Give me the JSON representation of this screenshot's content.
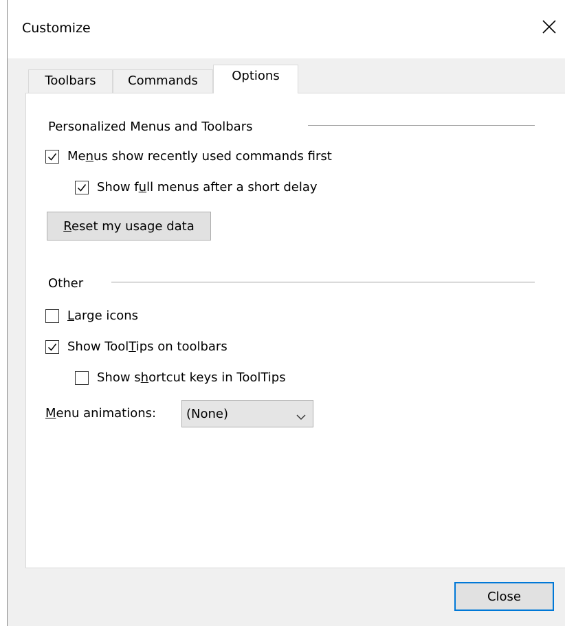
{
  "window": {
    "title": "Customize",
    "close_icon": "close-icon"
  },
  "tabs": [
    {
      "label": "Toolbars",
      "active": false
    },
    {
      "label": "Commands",
      "active": false
    },
    {
      "label": "Options",
      "active": true
    }
  ],
  "personalized": {
    "group_label": "Personalized Menus and Toolbars",
    "menus_recent": {
      "pre": "Me",
      "key": "n",
      "post": "us show recently used commands first",
      "checked": true
    },
    "full_menus": {
      "pre": "Show f",
      "key": "u",
      "post": "ll menus after a short delay",
      "checked": true
    },
    "reset_button": {
      "key": "R",
      "post": "eset my usage data"
    }
  },
  "other": {
    "group_label": "Other",
    "large_icons": {
      "pre": "",
      "key": "L",
      "post": "arge icons",
      "checked": false
    },
    "show_tooltips": {
      "pre": "Show Tool",
      "key": "T",
      "post": "ips on toolbars",
      "checked": true
    },
    "shortcut_keys": {
      "pre": "Show s",
      "key": "h",
      "post": "ortcut keys in ToolTips",
      "checked": false
    },
    "menu_animations": {
      "label_key": "M",
      "label_post": "enu animations:",
      "value": "(None)"
    }
  },
  "footer": {
    "close_label": "Close"
  },
  "colors": {
    "dialog_bg": "#f0f0f0",
    "panel_bg": "#ffffff",
    "button_bg": "#e1e1e1",
    "default_button_border": "#0078d7"
  }
}
